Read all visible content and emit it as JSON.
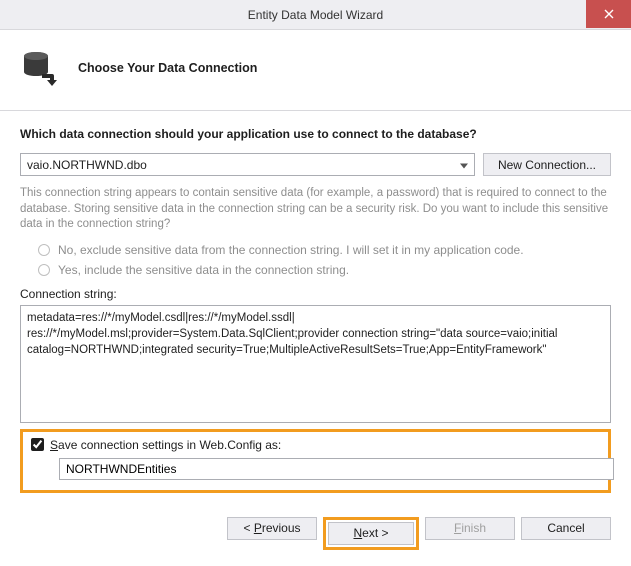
{
  "window": {
    "title": "Entity Data Model Wizard"
  },
  "header": {
    "subtitle": "Choose Your Data Connection"
  },
  "prompt": "Which data connection should your application use to connect to the database?",
  "dropdown": {
    "selected": "vaio.NORTHWND.dbo"
  },
  "buttons": {
    "new_connection": "New Connection...",
    "previous_prefix": "< ",
    "previous_und": "P",
    "previous_rest": "revious",
    "next_und": "N",
    "next_rest": "ext >",
    "finish_und": "F",
    "finish_rest": "inish",
    "cancel": "Cancel"
  },
  "sensitive_message": "This connection string appears to contain sensitive data (for example, a password) that is required to connect to the database. Storing sensitive data in the connection string can be a security risk. Do you want to include this sensitive data in the connection string?",
  "radio_no": "No, exclude sensitive data from the connection string. I will set it in my application code.",
  "radio_yes": "Yes, include the sensitive data in the connection string.",
  "conn_label": "Connection string:",
  "connection_string": "metadata=res://*/myModel.csdl|res://*/myModel.ssdl|\nres://*/myModel.msl;provider=System.Data.SqlClient;provider connection string=\"data source=vaio;initial catalog=NORTHWND;integrated security=True;MultipleActiveResultSets=True;App=EntityFramework\"",
  "save_label_und": "S",
  "save_label_rest": "ave connection settings in Web.Config as:",
  "entity_name": "NORTHWNDEntities"
}
